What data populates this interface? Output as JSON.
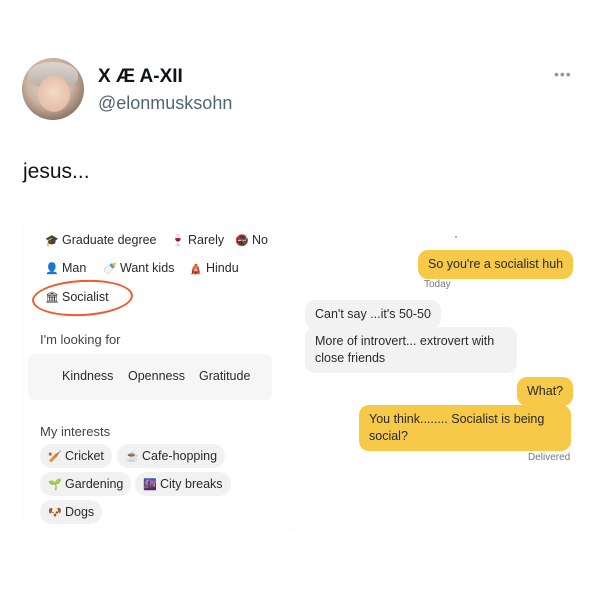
{
  "tweet": {
    "display_name": "X Æ A-XII",
    "handle": "@elonmusksohn",
    "text": "jesus...",
    "more_icon": "more-horizontal-icon"
  },
  "profile_card": {
    "chips_row1": [
      {
        "icon": "graduation-cap-icon",
        "glyph": "🎓",
        "label": "Graduate degree"
      },
      {
        "icon": "wine-glass-icon",
        "glyph": "🍷",
        "label": "Rarely"
      },
      {
        "icon": "no-smoking-icon",
        "glyph": "🚭",
        "label": "No"
      }
    ],
    "chips_row2": [
      {
        "icon": "person-icon",
        "glyph": "👤",
        "label": "Man"
      },
      {
        "icon": "pacifier-icon",
        "glyph": "🍼",
        "label": "Want kids"
      },
      {
        "icon": "religion-icon",
        "glyph": "🛕",
        "label": "Hindu"
      }
    ],
    "chips_row3": [
      {
        "icon": "government-building-icon",
        "glyph": "🏛",
        "label": "Socialist"
      }
    ],
    "looking_for_label": "I'm looking for",
    "looking_for": [
      "Kindness",
      "Openness",
      "Gratitude"
    ],
    "interests_label": "My interests",
    "interests": [
      {
        "icon": "cricket-icon",
        "glyph": "🏏",
        "label": "Cricket"
      },
      {
        "icon": "coffee-icon",
        "glyph": "☕",
        "label": "Cafe-hopping"
      },
      {
        "icon": "seedling-icon",
        "glyph": "🌱",
        "label": "Gardening"
      },
      {
        "icon": "city-night-icon",
        "glyph": "🌆",
        "label": "City breaks"
      },
      {
        "icon": "dog-icon",
        "glyph": "🐶",
        "label": "Dogs"
      }
    ],
    "highlight_color": "#f05a28"
  },
  "chat": {
    "messages": [
      {
        "from": "me",
        "text": "So you're a socialist huh"
      },
      {
        "from": "them",
        "text": "Can't say ...it's 50-50"
      },
      {
        "from": "them",
        "text": "More of introvert... extrovert with close friends"
      },
      {
        "from": "me",
        "text": "What?"
      },
      {
        "from": "me",
        "text": "You think........ Socialist is being social?"
      }
    ],
    "today_label": "Today",
    "delivered_label": "Delivered",
    "accent_color": "#f7c948"
  }
}
